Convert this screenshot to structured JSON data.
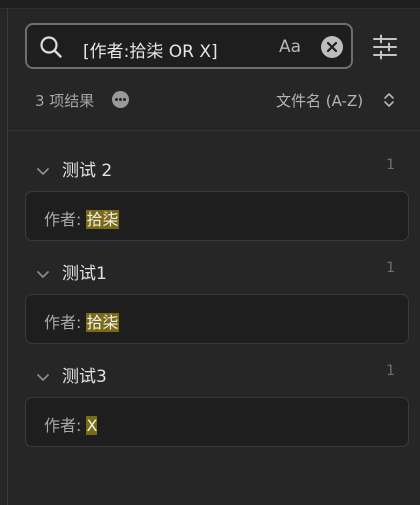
{
  "search": {
    "query": "[作者:拾柒 OR X]",
    "case_label": "Aa"
  },
  "summary": {
    "result_count": "3 项结果",
    "sort_label": "文件名 (A-Z)"
  },
  "groups": [
    {
      "title": "测试 2",
      "count": "1",
      "match": {
        "prefix": "作者: ",
        "highlight": "拾柒"
      }
    },
    {
      "title": "测试1",
      "count": "1",
      "match": {
        "prefix": "作者: ",
        "highlight": "拾柒"
      }
    },
    {
      "title": "测试3",
      "count": "1",
      "match": {
        "prefix": "作者: ",
        "highlight": "X"
      }
    }
  ],
  "colors": {
    "background": "#262626",
    "highlight": "#7a6a14",
    "input_border": "#6e6e6e"
  },
  "icons": {
    "search": "search-icon",
    "clear": "close-circle-icon",
    "filter": "sliders-icon",
    "more": "more-dots-icon",
    "sort": "chevron-up-down-icon",
    "collapse": "chevron-down-icon"
  }
}
